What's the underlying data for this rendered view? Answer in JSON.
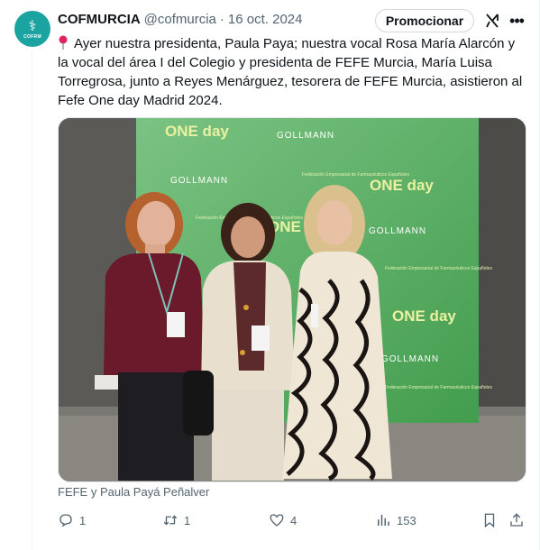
{
  "author": {
    "name": "COFMURCIA",
    "handle": "@cofmurcia",
    "separator": "·",
    "date": "16 oct. 2024",
    "avatar_text": "COFRM"
  },
  "header": {
    "promote_label": "Promocionar",
    "grok_icon": "grok-icon",
    "more_icon": "more-icon"
  },
  "tweet": {
    "pin_icon": "round-pushpin",
    "text": "Ayer nuestra presidenta, Paula Paya; nuestra vocal Rosa María Alarcón y la vocal del área I del Colegio y presidenta de FEFE Murcia, María Luisa Torregrosa, junto a Reyes Menárguez, tesorera de FEFE Murcia, asistieron al Fefe One day Madrid 2024."
  },
  "media": {
    "credit": "FEFE y Paula Payá Peñalver",
    "backdrop_texts": [
      "ONE day",
      "GOLLMANN",
      "Federación Empresarial de Farmacéuticos Españoles"
    ]
  },
  "actions": {
    "reply_count": "1",
    "retweet_count": "1",
    "like_count": "4",
    "views_count": "153"
  },
  "colors": {
    "text_primary": "#0f1419",
    "text_secondary": "#536471",
    "border": "#cfd9de",
    "backdrop_green": "#4fae5a",
    "avatar_teal": "#1aa3a0"
  }
}
